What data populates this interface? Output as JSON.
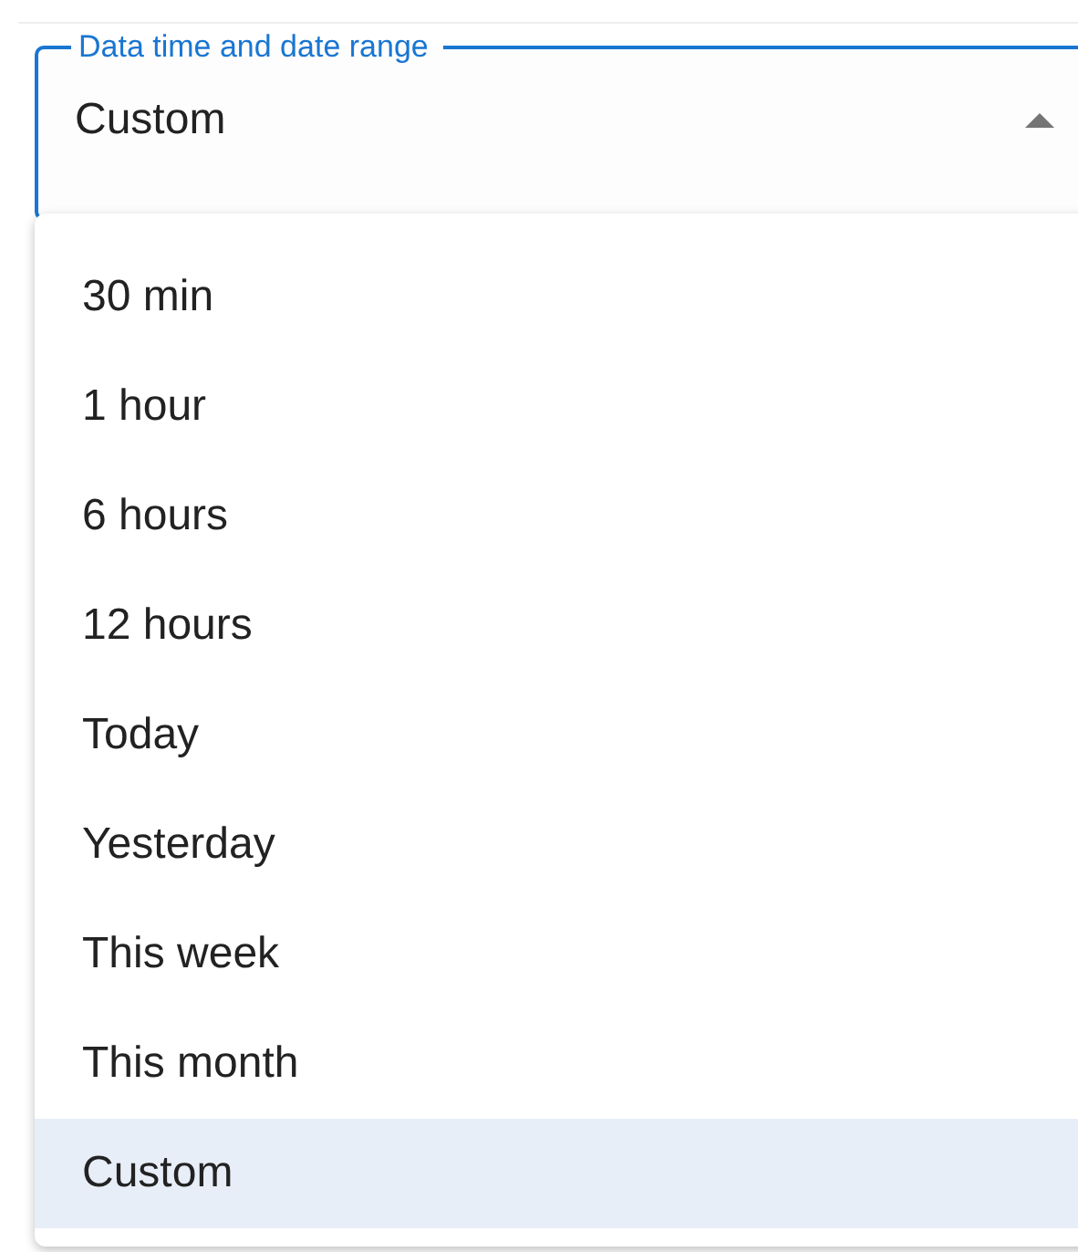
{
  "field": {
    "label": "Data time and date range",
    "value": "Custom",
    "open": true
  },
  "options": [
    {
      "label": "30 min",
      "selected": false
    },
    {
      "label": "1 hour",
      "selected": false
    },
    {
      "label": "6 hours",
      "selected": false
    },
    {
      "label": "12 hours",
      "selected": false
    },
    {
      "label": "Today",
      "selected": false
    },
    {
      "label": "Yesterday",
      "selected": false
    },
    {
      "label": "This week",
      "selected": false
    },
    {
      "label": "This month",
      "selected": false
    },
    {
      "label": "Custom",
      "selected": true
    }
  ]
}
